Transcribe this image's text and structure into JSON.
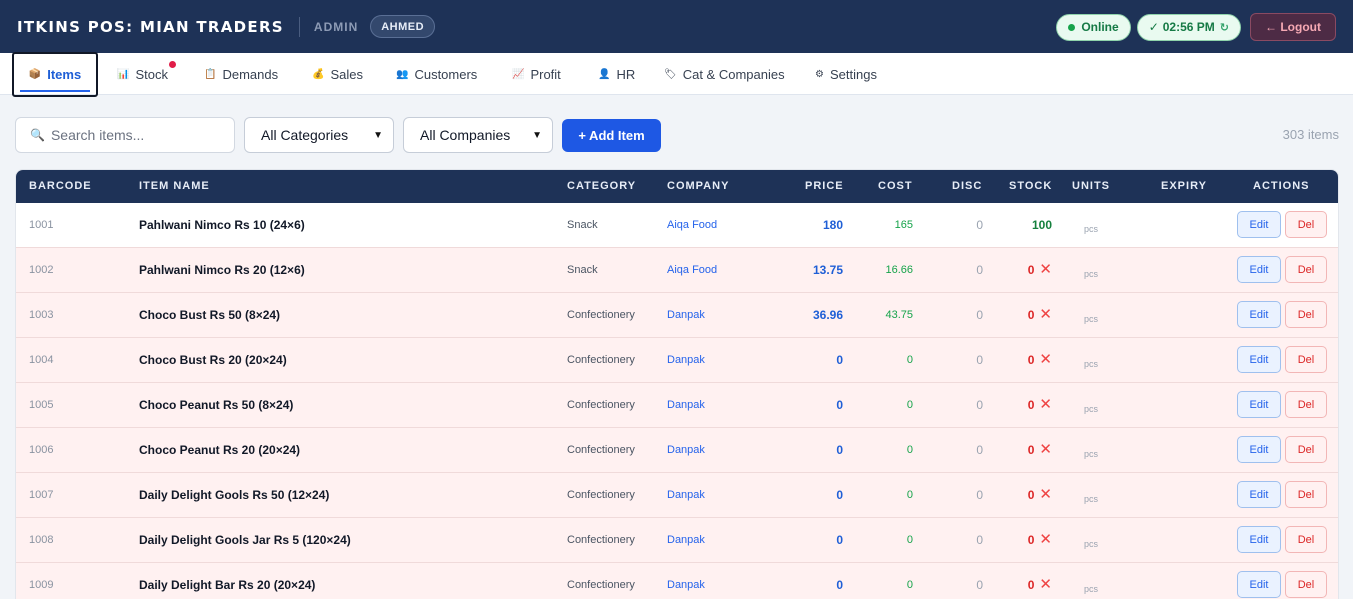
{
  "header": {
    "brand": "Itkins POS: Mian Traders",
    "role": "ADMIN",
    "user": "AHMED",
    "status": "Online",
    "time": "02:56 PM",
    "logout": "← Logout"
  },
  "tabs": [
    {
      "icon": "📦",
      "label": "Items"
    },
    {
      "icon": "📊",
      "label": "Stock"
    },
    {
      "icon": "📋",
      "label": "Demands"
    },
    {
      "icon": "💰",
      "label": "Sales"
    },
    {
      "icon": "👥",
      "label": "Customers"
    },
    {
      "icon": "📈",
      "label": "Profit"
    },
    {
      "icon": "👤",
      "label": "HR"
    },
    {
      "icon": "🏷",
      "label": "Cat & Companies"
    },
    {
      "icon": "⚙",
      "label": "Settings"
    }
  ],
  "controls": {
    "search_placeholder": "Search items...",
    "category": "All Categories",
    "company": "All Companies",
    "add_item": "+ Add Item",
    "count": "303 items"
  },
  "table": {
    "columns": [
      "BARCODE",
      "ITEM NAME",
      "CATEGORY",
      "COMPANY",
      "PRICE",
      "COST",
      "DISC",
      "STOCK",
      "UNITS",
      "EXPIRY",
      "ACTIONS"
    ],
    "rows": [
      {
        "barcode": "1001",
        "name": "Pahlwani Nimco Rs 10 (24×6)",
        "category": "Snack",
        "company": "Aiqa Food",
        "price": "180",
        "cost": "165",
        "disc": "0",
        "stock": "100",
        "unit": "pcs",
        "in_stock": true
      },
      {
        "barcode": "1002",
        "name": "Pahlwani Nimco Rs 20 (12×6)",
        "category": "Snack",
        "company": "Aiqa Food",
        "price": "13.75",
        "cost": "16.66",
        "disc": "0",
        "stock": "0",
        "unit": "pcs",
        "in_stock": false
      },
      {
        "barcode": "1003",
        "name": "Choco Bust Rs 50 (8×24)",
        "category": "Confectionery",
        "company": "Danpak",
        "price": "36.96",
        "cost": "43.75",
        "disc": "0",
        "stock": "0",
        "unit": "pcs",
        "in_stock": false
      },
      {
        "barcode": "1004",
        "name": "Choco Bust Rs 20 (20×24)",
        "category": "Confectionery",
        "company": "Danpak",
        "price": "0",
        "cost": "0",
        "disc": "0",
        "stock": "0",
        "unit": "pcs",
        "in_stock": false
      },
      {
        "barcode": "1005",
        "name": "Choco Peanut Rs 50 (8×24)",
        "category": "Confectionery",
        "company": "Danpak",
        "price": "0",
        "cost": "0",
        "disc": "0",
        "stock": "0",
        "unit": "pcs",
        "in_stock": false
      },
      {
        "barcode": "1006",
        "name": "Choco Peanut Rs 20 (20×24)",
        "category": "Confectionery",
        "company": "Danpak",
        "price": "0",
        "cost": "0",
        "disc": "0",
        "stock": "0",
        "unit": "pcs",
        "in_stock": false
      },
      {
        "barcode": "1007",
        "name": "Daily Delight Gools Rs 50 (12×24)",
        "category": "Confectionery",
        "company": "Danpak",
        "price": "0",
        "cost": "0",
        "disc": "0",
        "stock": "0",
        "unit": "pcs",
        "in_stock": false
      },
      {
        "barcode": "1008",
        "name": "Daily Delight Gools Jar Rs 5 (120×24)",
        "category": "Confectionery",
        "company": "Danpak",
        "price": "0",
        "cost": "0",
        "disc": "0",
        "stock": "0",
        "unit": "pcs",
        "in_stock": false
      },
      {
        "barcode": "1009",
        "name": "Daily Delight Bar Rs 20 (20×24)",
        "category": "Confectionery",
        "company": "Danpak",
        "price": "0",
        "cost": "0",
        "disc": "0",
        "stock": "0",
        "unit": "pcs",
        "in_stock": false
      }
    ],
    "edit_label": "Edit",
    "del_label": "Del"
  }
}
